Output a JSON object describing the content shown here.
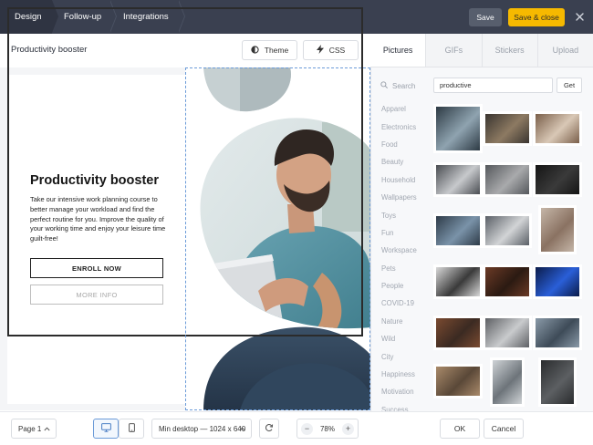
{
  "topbar": {
    "steps": [
      "Design",
      "Follow-up",
      "Integrations"
    ],
    "save_label": "Save",
    "save_close_label": "Save & close",
    "close_icon": "close-icon"
  },
  "editor": {
    "title": "Productivity booster",
    "theme_label": "Theme",
    "css_label": "CSS",
    "theme_icon": "contrast-icon",
    "css_icon": "lightning-icon"
  },
  "popup": {
    "heading": "Productivity booster",
    "body": "Take our intensive work planning course to better manage your workload and find the perfect routine for you. Improve the quality of your working time and enjoy your leisure time guilt-free!",
    "primary_button": "ENROLL NOW",
    "secondary_button": "MORE INFO"
  },
  "bottombar": {
    "page_label": "Page 1",
    "size_label": "Min desktop — 1024 x 640",
    "zoom": "78%",
    "zoom_minus": "−",
    "zoom_plus": "+",
    "ok_label": "OK",
    "cancel_label": "Cancel"
  },
  "panel": {
    "tabs": [
      "Pictures",
      "GIFs",
      "Stickers",
      "Upload"
    ],
    "active_tab": "Pictures",
    "search_label": "Search",
    "search_value": "productive",
    "get_label": "Get",
    "categories": [
      "Apparel",
      "Electronics",
      "Food",
      "Beauty",
      "Household",
      "Wallpapers",
      "Toys",
      "Fun",
      "Workspace",
      "Pets",
      "People",
      "COVID-19",
      "Nature",
      "Wild",
      "City",
      "Happiness",
      "Motivation",
      "Success"
    ],
    "thumbnails": [
      {
        "alt": "laptop desk workspace"
      },
      {
        "alt": "dark desk lamp"
      },
      {
        "alt": "hands typing on laptop"
      },
      {
        "alt": "productivity sign"
      },
      {
        "alt": "office desk"
      },
      {
        "alt": "do something great"
      },
      {
        "alt": "person with phone"
      },
      {
        "alt": "laptop with coffee"
      },
      {
        "alt": "woman with notebook"
      },
      {
        "alt": "you got this"
      },
      {
        "alt": "live work create"
      },
      {
        "alt": "neon sign"
      },
      {
        "alt": "laptop in office"
      },
      {
        "alt": "laptop on table"
      },
      {
        "alt": "team meeting"
      },
      {
        "alt": "office interior"
      },
      {
        "alt": "woman writing"
      },
      {
        "alt": "quote board"
      }
    ]
  },
  "colors": {
    "topbar": "#3a4050",
    "accent": "#f6b900",
    "selection": "#6b9bd8"
  }
}
